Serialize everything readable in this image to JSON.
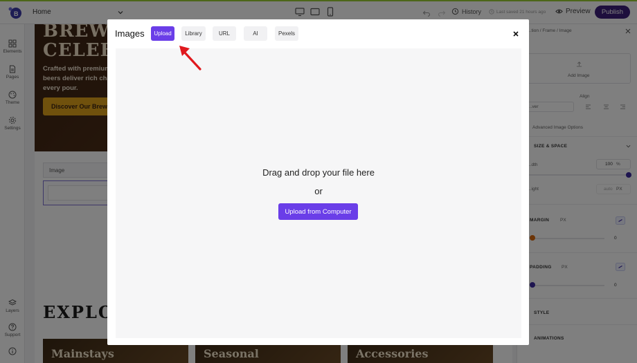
{
  "topbar": {
    "page_select": "Home",
    "history_label": "History",
    "saved_label": "Last saved 21 hours ago",
    "preview_label": "Preview",
    "publish_label": "Publish",
    "accent_color": "#9acd32",
    "publish_color": "#3d1f7a"
  },
  "leftrail": {
    "items": [
      {
        "label": "Elements",
        "icon": "grid-icon"
      },
      {
        "label": "Pages",
        "icon": "page-icon"
      },
      {
        "label": "Theme",
        "icon": "palette-icon"
      },
      {
        "label": "Settings",
        "icon": "gear-icon"
      },
      {
        "label": "Layers",
        "icon": "layers-icon"
      },
      {
        "label": "Support",
        "icon": "help-icon"
      },
      {
        "label": "",
        "icon": "info-icon"
      }
    ]
  },
  "canvas": {
    "hero_title_line1": "BREW",
    "hero_title_line2": "CELEB",
    "hero_text": "Crafted with premium beers deliver rich char every pour.",
    "hero_button": "Discover Our Brews",
    "image_block_label": "Image",
    "explore_heading": "EXPLO",
    "cards": [
      "Mainstays",
      "Seasonal",
      "Accessories"
    ]
  },
  "rightpanel": {
    "breadcrumb": "…tion / Frame / Image",
    "add_image": "Add Image",
    "align_label": "Align",
    "cover_value": "…ver",
    "advanced_options": "Advanced Image Options",
    "size_space": "SIZE & SPACE",
    "width_label": "…dth",
    "width_value": "100",
    "width_unit": "%",
    "height_label": "…ight",
    "height_value": "auto",
    "height_unit": "PX",
    "margin_label": "MARGIN",
    "margin_unit": "PX",
    "margin_value": "0",
    "padding_label": "PADDING",
    "padding_unit": "PX",
    "padding_value": "0",
    "style_label": "STYLE",
    "animations_label": "ANIMATIONS"
  },
  "modal": {
    "title": "Images",
    "tabs": [
      {
        "label": "Upload",
        "active": true
      },
      {
        "label": "Library",
        "active": false
      },
      {
        "label": "URL",
        "active": false
      },
      {
        "label": "AI",
        "active": false
      },
      {
        "label": "Pexels",
        "active": false
      }
    ],
    "drop_text": "Drag and drop your file here",
    "or_text": "or",
    "upload_button": "Upload from Computer",
    "accent_color": "#6a3ee8"
  }
}
